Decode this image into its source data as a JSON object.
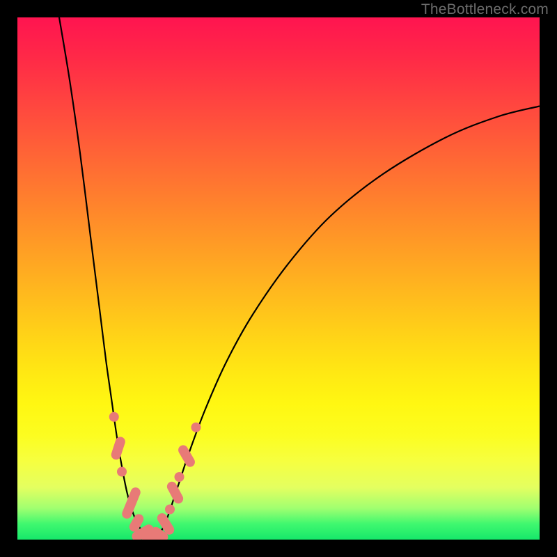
{
  "watermark": "TheBottleneck.com",
  "colors": {
    "dot": "#e87a77",
    "curve": "#000000"
  },
  "chart_data": {
    "type": "line",
    "title": "",
    "xlabel": "",
    "ylabel": "",
    "xlim": [
      0,
      100
    ],
    "ylim": [
      0,
      100
    ],
    "grid": false,
    "legend": false,
    "series": [
      {
        "name": "left-branch",
        "x": [
          8,
          10,
          12,
          14,
          15,
          16,
          17,
          18,
          19,
          20,
          21,
          22,
          23,
          24,
          25,
          26
        ],
        "y": [
          100,
          88,
          74,
          58,
          50,
          42,
          34,
          27,
          20,
          14,
          9,
          5.5,
          3,
          1.5,
          0.6,
          0.15
        ]
      },
      {
        "name": "right-branch",
        "x": [
          26,
          27,
          28,
          29,
          30,
          31,
          33,
          36,
          40,
          45,
          52,
          60,
          70,
          82,
          92,
          100
        ],
        "y": [
          0.15,
          0.9,
          2.5,
          5,
          8,
          11,
          17,
          25,
          34,
          43,
          53,
          62,
          70,
          77,
          81,
          83
        ]
      }
    ],
    "markers": {
      "name": "highlighted-points",
      "color": "#e87a77",
      "points": [
        {
          "x": 18.5,
          "y": 23.5,
          "kind": "dot"
        },
        {
          "x": 19.3,
          "y": 17.5,
          "kind": "pill",
          "len": 5,
          "angle": -72
        },
        {
          "x": 20.0,
          "y": 13.0,
          "kind": "dot"
        },
        {
          "x": 21.8,
          "y": 7.0,
          "kind": "pill",
          "len": 7,
          "angle": -68
        },
        {
          "x": 22.8,
          "y": 3.2,
          "kind": "pill",
          "len": 4,
          "angle": -60
        },
        {
          "x": 24.0,
          "y": 1.3,
          "kind": "pill",
          "len": 5,
          "angle": -30
        },
        {
          "x": 25.6,
          "y": 0.3,
          "kind": "pill",
          "len": 4,
          "angle": -8
        },
        {
          "x": 27.2,
          "y": 1.0,
          "kind": "pill",
          "len": 4,
          "angle": 35
        },
        {
          "x": 28.4,
          "y": 3.0,
          "kind": "pill",
          "len": 5,
          "angle": 58
        },
        {
          "x": 29.2,
          "y": 5.8,
          "kind": "dot"
        },
        {
          "x": 30.2,
          "y": 9.0,
          "kind": "pill",
          "len": 5,
          "angle": 62
        },
        {
          "x": 31.0,
          "y": 12.0,
          "kind": "dot"
        },
        {
          "x": 32.4,
          "y": 16.0,
          "kind": "pill",
          "len": 5,
          "angle": 60
        },
        {
          "x": 34.2,
          "y": 21.5,
          "kind": "dot"
        }
      ]
    }
  }
}
